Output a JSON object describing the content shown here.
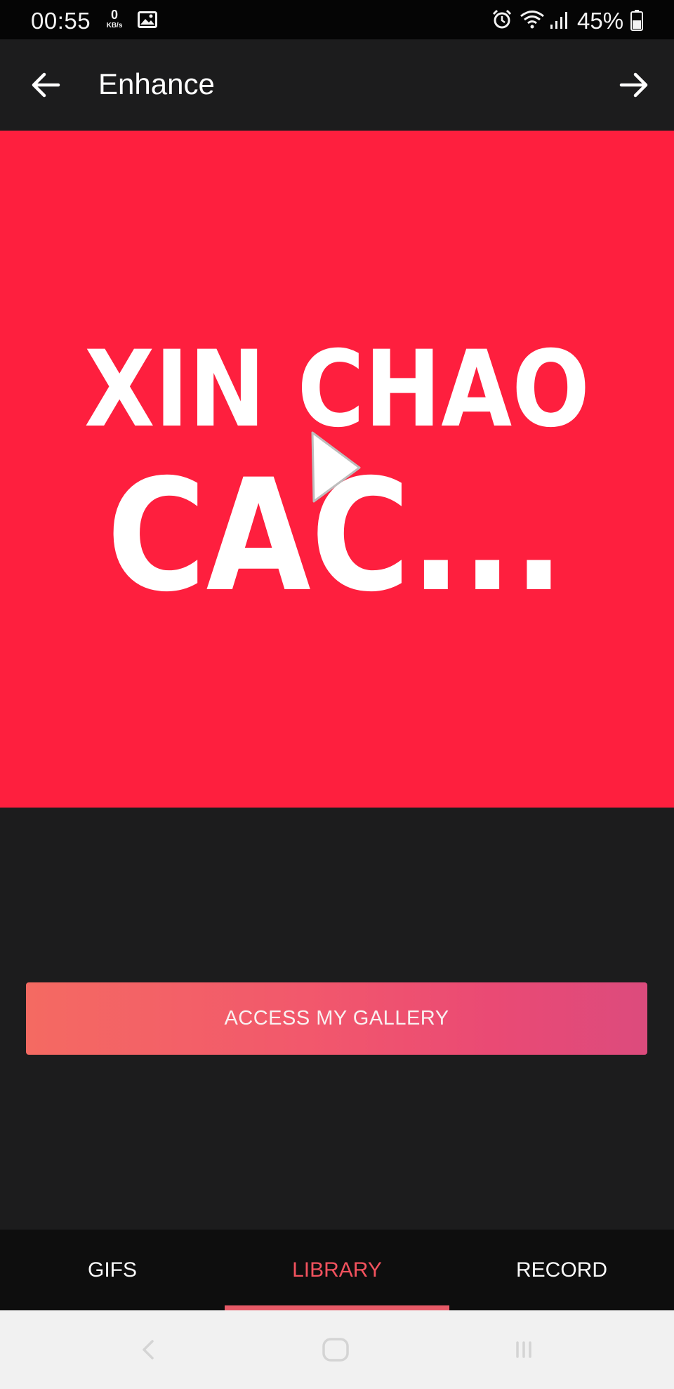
{
  "status_bar": {
    "time": "00:55",
    "net_speed_value": "0",
    "net_speed_unit": "KB/s",
    "battery": "45%",
    "icons": [
      "gallery-icon",
      "alarm-icon",
      "wifi-icon",
      "signal-icon",
      "battery-icon"
    ]
  },
  "app_bar": {
    "title": "Enhance",
    "back_icon": "arrow-left-icon",
    "next_icon": "arrow-right-icon"
  },
  "preview": {
    "background": "#fe1f3e",
    "line1": "XIN CHAO",
    "line2": "CAC...",
    "play_icon": "play-icon"
  },
  "gallery_button": {
    "label": "ACCESS MY GALLERY"
  },
  "tabs": [
    {
      "label": "GIFS",
      "active": false
    },
    {
      "label": "LIBRARY",
      "active": true
    },
    {
      "label": "RECORD",
      "active": false
    }
  ],
  "colors": {
    "accent": "#f2525e",
    "surface": "#1c1c1d",
    "preview_red": "#fe1f3e"
  }
}
